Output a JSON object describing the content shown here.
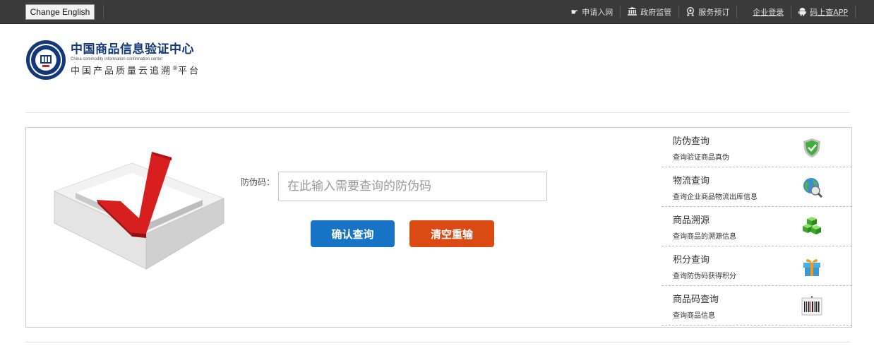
{
  "topbar": {
    "lang_button": "Change English",
    "nav": [
      {
        "label": "申请入网",
        "icon": "hand-point-icon"
      },
      {
        "label": "政府监管",
        "icon": "government-building-icon"
      },
      {
        "label": "服务预订",
        "icon": "badge-icon"
      },
      {
        "label": "企业登录",
        "icon": ""
      },
      {
        "label": "码上查APP",
        "icon": "android-icon"
      }
    ]
  },
  "header": {
    "title_cn": "中国商品信息验证中心",
    "title_en": "China commodity information confirmation center",
    "subtitle_cn": "中国产品质量云追溯",
    "subtitle_reg": "®",
    "subtitle_tail": "平台"
  },
  "query": {
    "label": "防伪码：",
    "placeholder": "在此输入需要查询的防伪码",
    "confirm_label": "确认查询",
    "clear_label": "清空重输"
  },
  "side": [
    {
      "title": "防伪查询",
      "desc": "查询验证商品真伪",
      "icon": "shield-check-icon"
    },
    {
      "title": "物流查询",
      "desc": "查询企业商品物流出库信息",
      "icon": "globe-search-icon"
    },
    {
      "title": "商品溯源",
      "desc": "查询商品的溯源信息",
      "icon": "cubes-icon"
    },
    {
      "title": "积分查询",
      "desc": "查询防伪码获得积分",
      "icon": "gift-icon"
    },
    {
      "title": "商品码查询",
      "desc": "查询商品信息",
      "icon": "barcode-icon"
    }
  ],
  "colors": {
    "topbar_bg": "#3a3a3a",
    "brand_blue": "#13377a",
    "confirm_button": "#1773c6",
    "clear_button": "#dc4a14",
    "check_red": "#d81f1f"
  }
}
